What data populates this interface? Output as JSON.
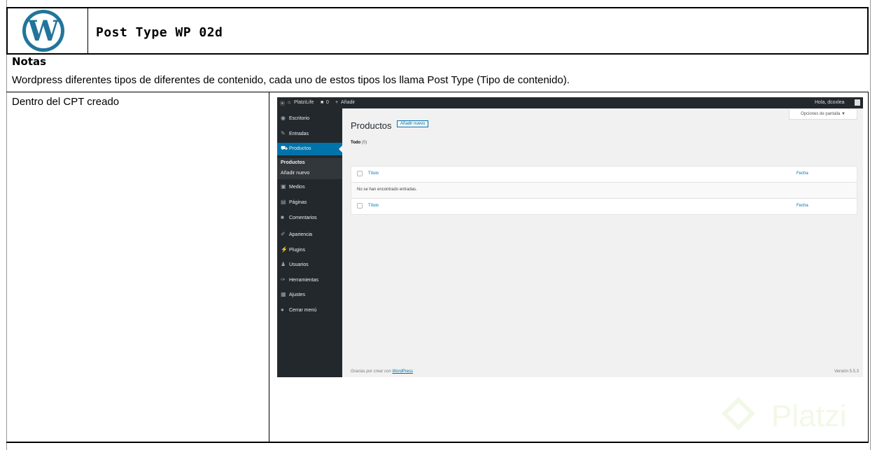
{
  "header": {
    "title": "Post Type WP 02d"
  },
  "notes": {
    "label": "Notas",
    "text": "Wordpress diferentes tipos de diferentes de contenido, cada uno de estos tipos los llama Post Type (Tipo de contenido)."
  },
  "body": {
    "left_text": "Dentro del CPT creado"
  },
  "wp": {
    "topbar": {
      "site": "PlatziLife",
      "comments": "0",
      "add": "Añadir",
      "greeting": "Hola, dcoxlea"
    },
    "sidebar": [
      {
        "label": "Escritorio",
        "icon": "dashboard-icon",
        "glyph": "◉"
      },
      {
        "label": "Entradas",
        "icon": "pin-icon",
        "glyph": "✎"
      },
      {
        "label": "Productos",
        "icon": "cart-icon",
        "glyph": "⛟"
      },
      {
        "label": "Productos",
        "icon": "",
        "glyph": ""
      },
      {
        "label": "Añadir nuevo",
        "icon": "",
        "glyph": ""
      },
      {
        "label": "Medios",
        "icon": "media-icon",
        "glyph": "▣"
      },
      {
        "label": "Páginas",
        "icon": "pages-icon",
        "glyph": "▤"
      },
      {
        "label": "Comentarios",
        "icon": "comments-icon",
        "glyph": "■"
      },
      {
        "label": "Apariencia",
        "icon": "brush-icon",
        "glyph": "✐"
      },
      {
        "label": "Plugins",
        "icon": "plugin-icon",
        "glyph": "⚡"
      },
      {
        "label": "Usuarios",
        "icon": "users-icon",
        "glyph": "♟"
      },
      {
        "label": "Herramientas",
        "icon": "wrench-icon",
        "glyph": "✑"
      },
      {
        "label": "Ajustes",
        "icon": "settings-icon",
        "glyph": "▦"
      },
      {
        "label": "Cerrar menú",
        "icon": "collapse-icon",
        "glyph": "●"
      }
    ],
    "page_title": "Productos",
    "add_new": "Añadir nuevo",
    "screen_options": "Opciones de pantalla ▼",
    "filter_all": "Todo",
    "filter_count": "(0)",
    "table": {
      "col_title": "Título",
      "col_date": "Fecha",
      "empty": "No se han encontrado entradas."
    },
    "footer_prefix": "Gracias por crear con ",
    "footer_link": "WordPress",
    "version": "Versión 5.5.3"
  },
  "watermark": "Platzi",
  "colors": {
    "wp_dark": "#23282d",
    "wp_blue": "#0073aa",
    "wp_bg": "#f1f1f1",
    "platzi_green": "#98ca3f"
  }
}
